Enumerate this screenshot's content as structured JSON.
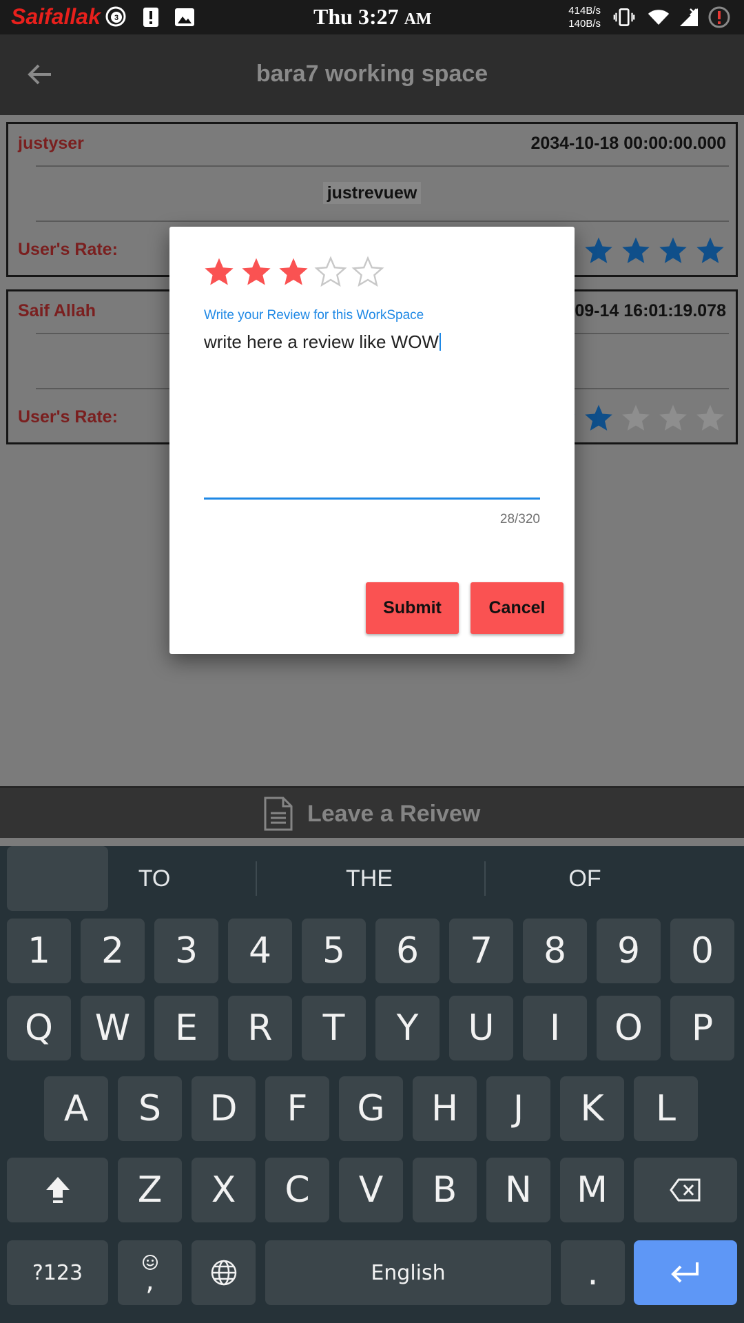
{
  "status_bar": {
    "brand": "Saifallak",
    "notification_count": "3",
    "time": "Thu 3:27",
    "ampm": "AM",
    "speed_up": "414B/s",
    "speed_down": "140B/s"
  },
  "app_bar": {
    "title": "bara7 working space"
  },
  "reviews": [
    {
      "user": "justyser",
      "date": "2034-10-18 00:00:00.000",
      "text": "justrevuew",
      "rate_label": "User's Rate:",
      "rating": 5
    },
    {
      "user": "Saif Allah",
      "date": "09-14 16:01:19.078",
      "text": "",
      "rate_label": "User's Rate:",
      "rating": 2
    }
  ],
  "dialog": {
    "rating": 3,
    "max_rating": 5,
    "field_label": "Write your Review for this WorkSpace",
    "field_value": "write here a review like WOW",
    "counter": "28/320",
    "submit_label": "Submit",
    "cancel_label": "Cancel",
    "accent_color": "#1e88e5",
    "button_color": "#fa5252",
    "star_color": "#fa5252"
  },
  "leave_bar": {
    "label": "Leave a Reivew",
    "icon": "document-icon"
  },
  "keyboard": {
    "suggestions": [
      "TO",
      "THE",
      "OF"
    ],
    "row_numbers": [
      "1",
      "2",
      "3",
      "4",
      "5",
      "6",
      "7",
      "8",
      "9",
      "0"
    ],
    "row_top": [
      "Q",
      "W",
      "E",
      "R",
      "T",
      "Y",
      "U",
      "I",
      "O",
      "P"
    ],
    "row_middle": [
      "A",
      "S",
      "D",
      "F",
      "G",
      "H",
      "J",
      "K",
      "L"
    ],
    "row_bottom": [
      "Z",
      "X",
      "C",
      "V",
      "B",
      "N",
      "M"
    ],
    "symbols_label": "?123",
    "comma_label": ",",
    "space_label": "English",
    "period_label": "."
  }
}
